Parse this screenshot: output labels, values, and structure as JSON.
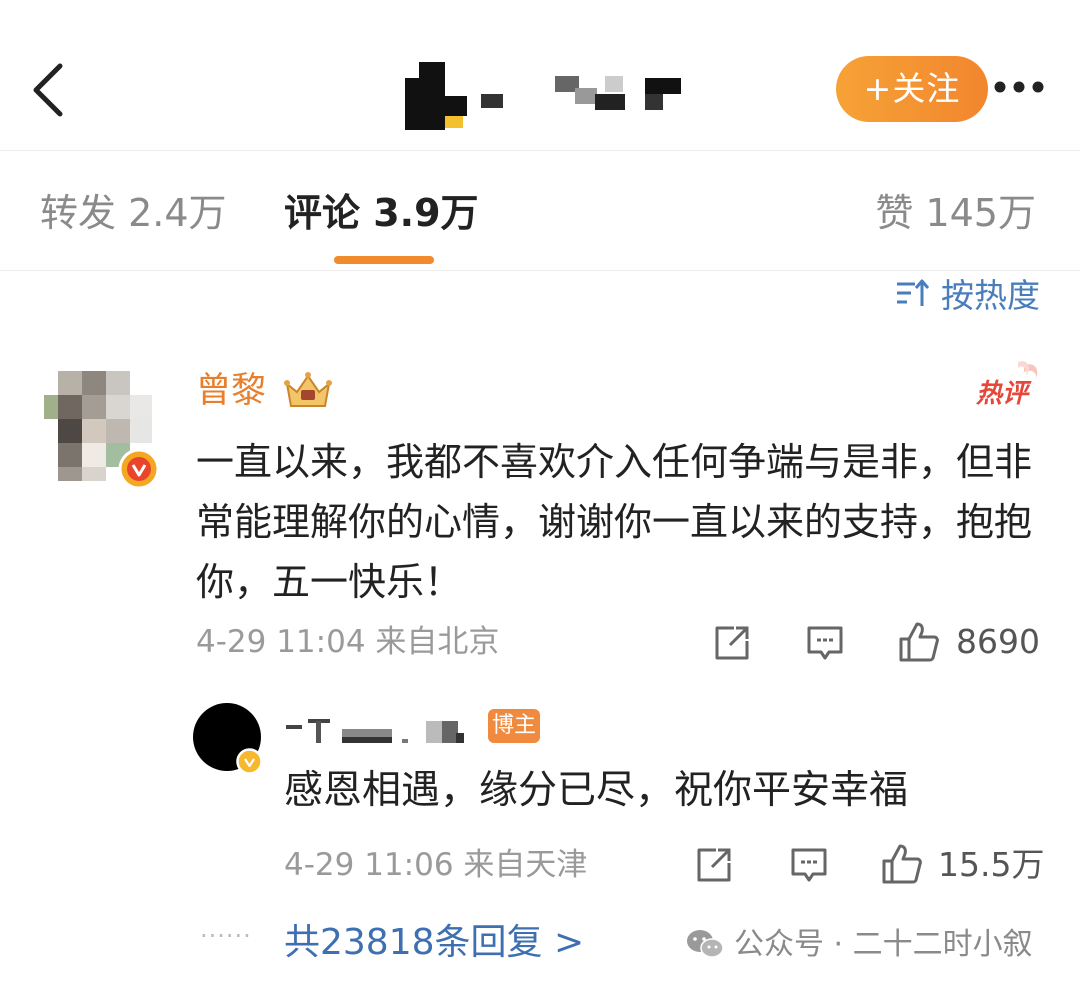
{
  "header": {
    "back_icon": "chevron-left-icon",
    "follow_label": "+关注",
    "more_icon": "more-horizontal-icon"
  },
  "tabs": {
    "repost": "转发 2.4万",
    "comment": "评论 3.9万",
    "like": "赞 145万"
  },
  "sort": {
    "icon": "sort-icon",
    "label": "按热度"
  },
  "comment": {
    "author": "曾黎",
    "hot_label": "热评",
    "text": "一直以来，我都不喜欢介入任何争端与是非，但非常能理解你的心情，谢谢你一直以来的支持，抱抱你，五一快乐！",
    "meta": "4-29 11:04 来自北京",
    "like_count": "8690"
  },
  "reply": {
    "badge": "博主",
    "text": "感恩相遇，缘分已尽，祝你平安幸福",
    "meta": "4-29 11:06 来自天津",
    "like_count": "15.5万"
  },
  "footer": {
    "dots": "······",
    "replies_link": "共23818条回复 >",
    "watermark": "公众号 · 二十二时小叙"
  },
  "colors": {
    "accent_orange": "#f08a2a",
    "link_blue": "#3e6fb0",
    "name_orange": "#e87f2d"
  }
}
